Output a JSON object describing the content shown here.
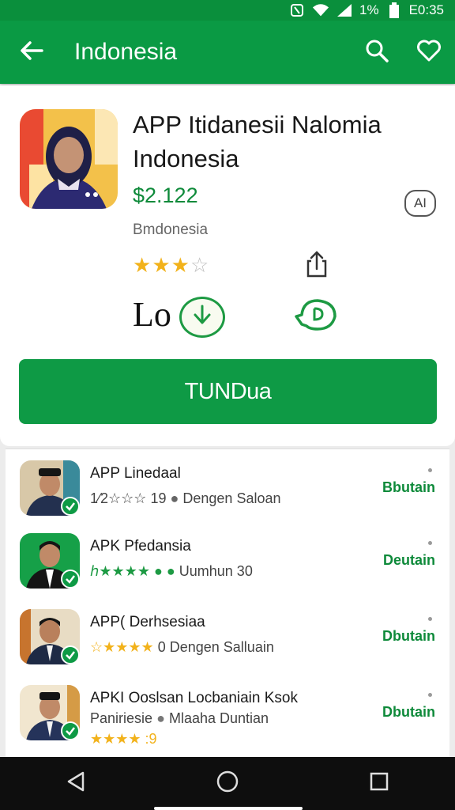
{
  "status_bar": {
    "time": "E0:35",
    "battery": "1%"
  },
  "app_bar": {
    "title": "Indonesia",
    "back_icon": "arrow-left-icon",
    "search_icon": "search-icon",
    "favorite_icon": "heart-icon"
  },
  "app": {
    "name": "APP Itidanesii Nalomia Indonesia",
    "price": "$2.122",
    "developer": "Bmdonesia",
    "badge": "AI",
    "rating": 3,
    "rating_max": 5,
    "size_label": "Lo",
    "install_label": "TUNDua"
  },
  "list": [
    {
      "title": "APP Linedaal",
      "stars_text": "1⁄2☆☆☆",
      "count": "19",
      "meta": "Dengen Saloan",
      "action": "Bbutain"
    },
    {
      "title": "APK Pfedansia",
      "stars_text": "ℎ★★★★",
      "count": "",
      "meta": "Uumhun 30",
      "action": "Deutain"
    },
    {
      "title": "APP( Derhsesiaa",
      "stars_text": "☆★★★★",
      "count": "0",
      "meta": "Dengen Salluain",
      "action": "Dbutain"
    },
    {
      "title": "APKI Ooslsan Locbaniain Ksok",
      "stars_text": "Paniriesie",
      "count": "",
      "meta": "Mlaaha Duntian",
      "action": "Dbutain",
      "rating_line": "★★★★ :9"
    }
  ],
  "colors": {
    "primary": "#0a9a44",
    "accent_text": "#0e8a3a",
    "star": "#f2b21b"
  }
}
